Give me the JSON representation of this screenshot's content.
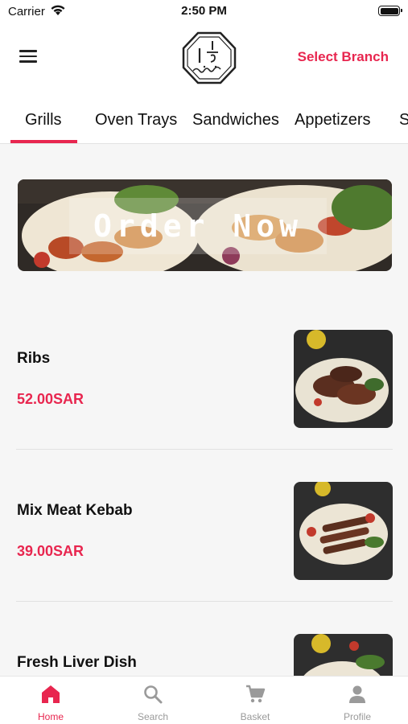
{
  "status_bar": {
    "carrier": "Carrier",
    "time": "2:50 PM"
  },
  "header": {
    "select_branch": "Select Branch",
    "logo_icon": "restaurant-logo-icon"
  },
  "colors": {
    "accent": "#e8264f",
    "inactive": "#9a9a9a"
  },
  "categories": [
    {
      "label": "Grills",
      "active": true
    },
    {
      "label": "Oven Trays",
      "active": false
    },
    {
      "label": "Sandwiches",
      "active": false
    },
    {
      "label": "Appetizers",
      "active": false
    },
    {
      "label": "S",
      "active": false
    }
  ],
  "banner": {
    "text": "Order Now"
  },
  "items": [
    {
      "name": "Ribs",
      "price": "52.00SAR"
    },
    {
      "name": "Mix Meat Kebab",
      "price": "39.00SAR"
    },
    {
      "name": "Fresh Liver Dish",
      "price": ""
    }
  ],
  "tabbar": [
    {
      "label": "Home",
      "icon": "home-icon",
      "active": true
    },
    {
      "label": "Search",
      "icon": "search-icon",
      "active": false
    },
    {
      "label": "Basket",
      "icon": "cart-icon",
      "active": false
    },
    {
      "label": "Profile",
      "icon": "profile-icon",
      "active": false
    }
  ]
}
